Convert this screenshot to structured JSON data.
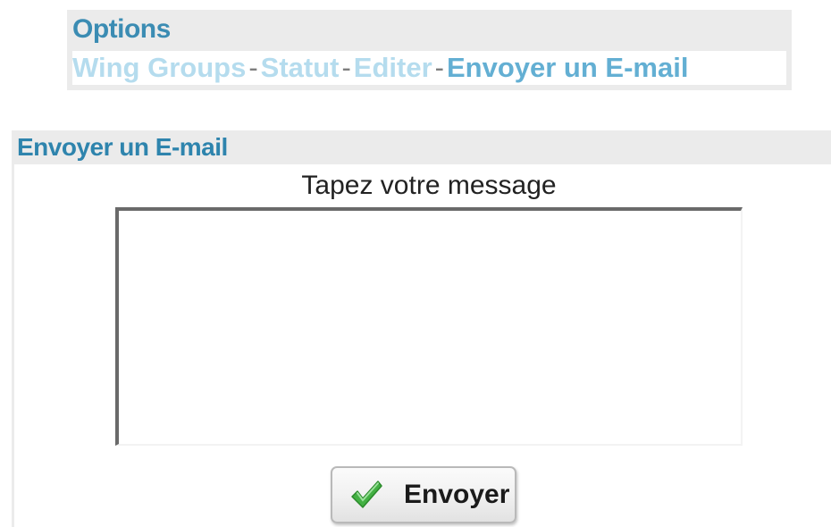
{
  "options": {
    "title": "Options",
    "links": [
      {
        "label": "Wing Groups",
        "active": false
      },
      {
        "label": "Statut",
        "active": false
      },
      {
        "label": "Editer",
        "active": false
      },
      {
        "label": "Envoyer un E-mail",
        "active": true
      }
    ],
    "separator": "-"
  },
  "email": {
    "header": "Envoyer un E-mail",
    "prompt": "Tapez votre message",
    "message_value": "",
    "send_label": "Envoyer",
    "send_icon": "checkmark-icon"
  },
  "colors": {
    "link_inactive": "#b5dcee",
    "link_active": "#63afd3",
    "header_text": "#2e84ad",
    "panel_bg": "#ebebeb",
    "check_green": "#3aa53a"
  }
}
